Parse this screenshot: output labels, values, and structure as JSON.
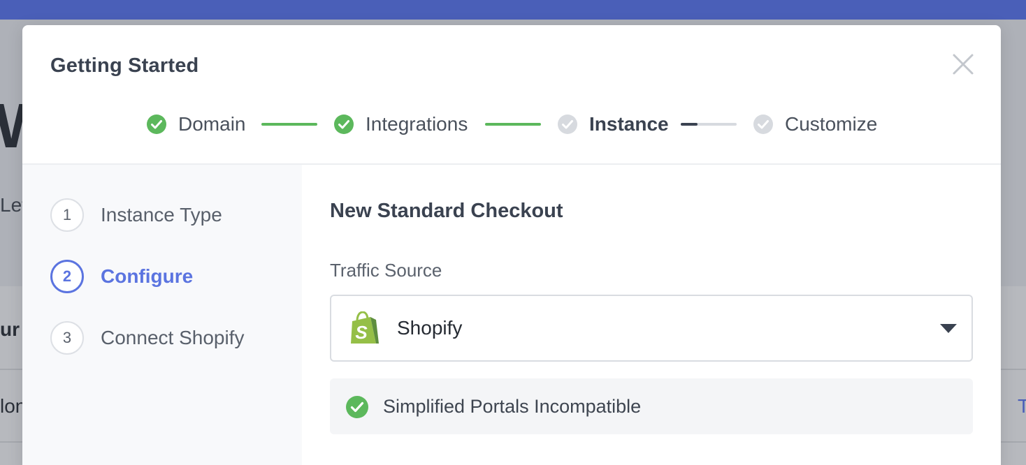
{
  "background": {
    "heading_fragment": "W",
    "subtext_fragment": "Let",
    "table_header_fragment": "ur l",
    "table_cell_fragment": "lon",
    "link_fragment": "T"
  },
  "modal": {
    "title": "Getting Started",
    "close_label": "close"
  },
  "stepper": {
    "steps": [
      {
        "label": "Domain",
        "status": "complete"
      },
      {
        "label": "Integrations",
        "status": "complete"
      },
      {
        "label": "Instance",
        "status": "current"
      },
      {
        "label": "Customize",
        "status": "upcoming"
      }
    ],
    "instance_progress": 0.3
  },
  "substeps": [
    {
      "number": "1",
      "label": "Instance Type",
      "active": false
    },
    {
      "number": "2",
      "label": "Configure",
      "active": true
    },
    {
      "number": "3",
      "label": "Connect Shopify",
      "active": false
    }
  ],
  "content": {
    "title": "New Standard Checkout",
    "traffic_source": {
      "label": "Traffic Source",
      "selected": "Shopify",
      "icon": "shopify-logo"
    },
    "notice": {
      "text": "Simplified Portals Incompatible",
      "icon": "check-circle-icon"
    }
  },
  "colors": {
    "topbar": "#4a5fb8",
    "success_green": "#5cb85c",
    "accent_blue": "#5b74e0",
    "pending_gray": "#d7dadf",
    "shopify_green": "#95bf47"
  }
}
